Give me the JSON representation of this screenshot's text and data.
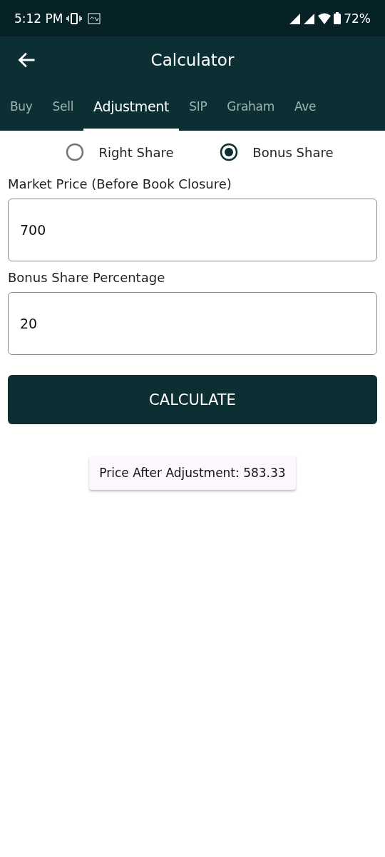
{
  "status_bar": {
    "time": "5:12 PM",
    "battery": "72%"
  },
  "app_bar": {
    "title": "Calculator"
  },
  "tabs": [
    {
      "label": "Buy",
      "selected": false
    },
    {
      "label": "Sell",
      "selected": false
    },
    {
      "label": "Adjustment",
      "selected": true
    },
    {
      "label": "SIP",
      "selected": false
    },
    {
      "label": "Graham",
      "selected": false
    },
    {
      "label": "Ave",
      "selected": false
    }
  ],
  "radios": [
    {
      "label": "Right Share",
      "selected": false
    },
    {
      "label": "Bonus Share",
      "selected": true
    }
  ],
  "fields": [
    {
      "label": "Market Price (Before Book Closure)",
      "value": "700"
    },
    {
      "label": "Bonus Share Percentage",
      "value": "20"
    }
  ],
  "button": "CALCULATE",
  "result": "Price After Adjustment: 583.33"
}
